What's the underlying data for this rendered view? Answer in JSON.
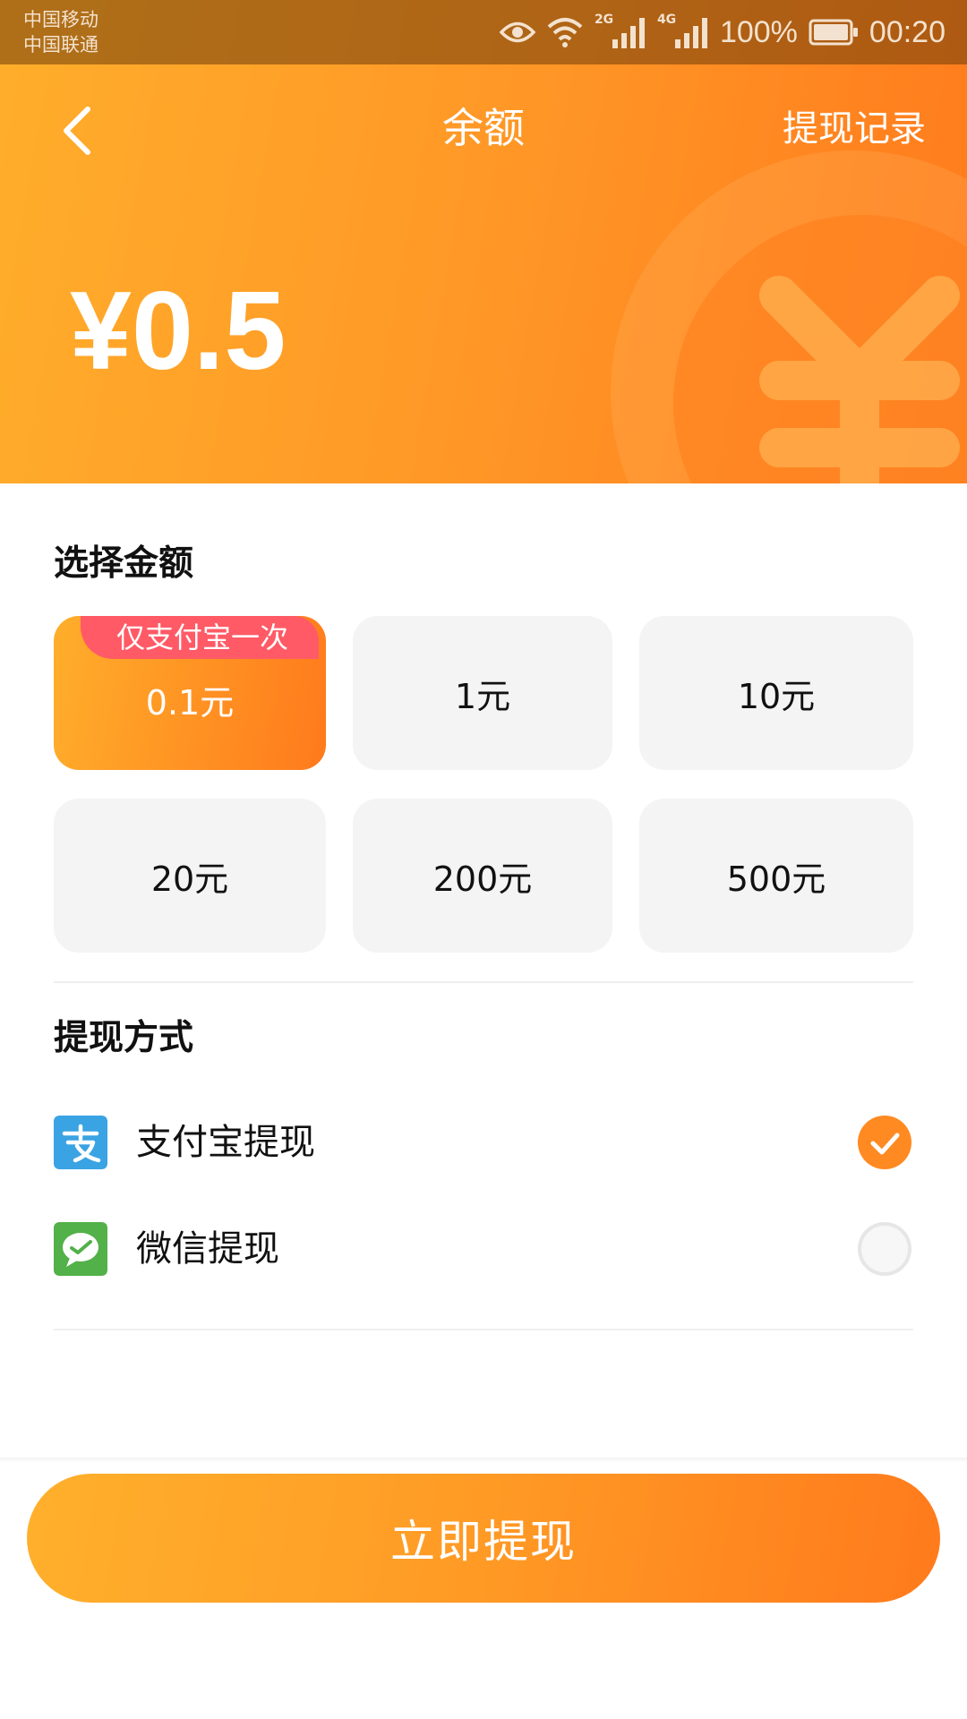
{
  "status_bar": {
    "carrier_1": "中国移动",
    "carrier_2": "中国联通",
    "network_1": "2G",
    "network_2": "4G",
    "battery": "100%",
    "time": "00:20"
  },
  "header": {
    "back_icon": "chevron-left-icon",
    "title": "余额",
    "history_link": "提现记录",
    "balance": "¥0.5",
    "background_gradient": [
      "#ffae2b",
      "#ff7a1c"
    ]
  },
  "amount_section": {
    "title": "选择金额",
    "options": [
      {
        "label": "0.1元",
        "badge": "仅支付宝一次",
        "selected": true
      },
      {
        "label": "1元",
        "selected": false
      },
      {
        "label": "10元",
        "selected": false
      },
      {
        "label": "20元",
        "selected": false
      },
      {
        "label": "200元",
        "selected": false
      },
      {
        "label": "500元",
        "selected": false
      }
    ],
    "selected_badge_color": "#ff5a66"
  },
  "method_section": {
    "title": "提现方式",
    "methods": [
      {
        "label": "支付宝提现",
        "icon": "alipay-icon",
        "icon_color": "#3aa3e3",
        "selected": true
      },
      {
        "label": "微信提现",
        "icon": "wechat-icon",
        "icon_color": "#52b148",
        "selected": false
      }
    ],
    "selected_color": "#ff8a22"
  },
  "action": {
    "withdraw_label": "立即提现"
  }
}
